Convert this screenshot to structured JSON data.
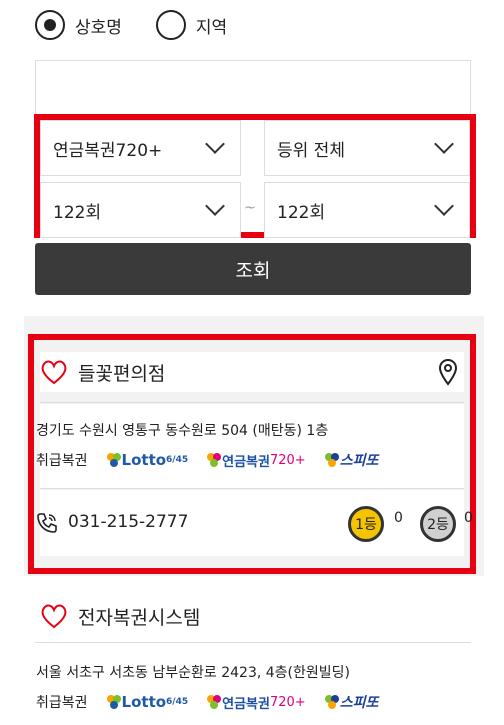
{
  "filter": {
    "radio_options": [
      {
        "label": "상호명",
        "checked": true
      },
      {
        "label": "지역",
        "checked": false
      }
    ],
    "search_value": "",
    "lottery_type": "연금복권720+",
    "rank": "등위 전체",
    "round_from": "122회",
    "round_to": "122회",
    "range_separator": "~",
    "search_button": "조회"
  },
  "stores": [
    {
      "name": "들꽃편의점",
      "address": "경기도 수원시 영통구 동수원로 504 (매탄동) 1층",
      "ticket_label": "취급복권",
      "tickets": [
        "Lotto6/45",
        "연금복권720+",
        "스피또"
      ],
      "phone": "031-215-2777",
      "first_prize_count": "0",
      "second_prize_count": "0",
      "first_medal": "1등",
      "second_medal": "2등"
    },
    {
      "name": "전자복권시스템",
      "address": "서울 서초구 서초동 남부순환로 2423, 4층(한원빌딩)",
      "ticket_label": "취급복권",
      "tickets": [
        "Lotto6/45",
        "연금복권720+",
        "스피또"
      ]
    }
  ],
  "logos": {
    "lotto_main": "Lotto",
    "lotto_sub": "6/45",
    "pension_main": "연금복권",
    "pension_sub": "720+",
    "speetto": "스피또"
  },
  "colors": {
    "highlight": "#e60012",
    "button_bg": "#3a3a3a",
    "heart": "#e60012",
    "gold_medal": "#f5c400",
    "silver_medal": "#d0d0d0"
  }
}
